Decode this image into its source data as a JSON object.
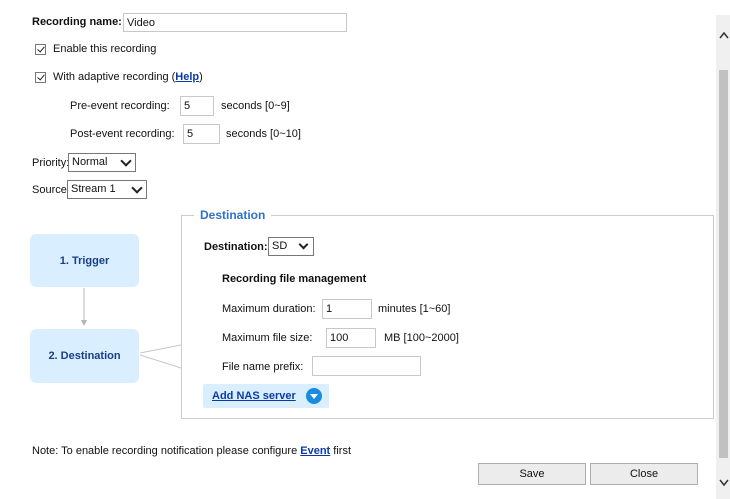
{
  "recording_name": {
    "label": "Recording name:",
    "value": "Video"
  },
  "enable_recording": {
    "label": "Enable this recording",
    "checked": true
  },
  "adaptive": {
    "label_prefix": "With adaptive recording (",
    "help": "Help",
    "label_suffix": ")",
    "checked": true
  },
  "pre_event": {
    "label": "Pre-event recording:",
    "value": "5",
    "unit": "seconds [0~9]"
  },
  "post_event": {
    "label": "Post-event recording:",
    "value": "5",
    "unit": "seconds [0~10]"
  },
  "priority": {
    "label": "Priority:",
    "value": "Normal"
  },
  "source": {
    "label": "Source:",
    "value": "Stream 1"
  },
  "flow": {
    "trigger": "1. Trigger",
    "destination": "2. Destination"
  },
  "destination_panel": {
    "legend": "Destination",
    "dest_label": "Destination:",
    "dest_value": "SD",
    "file_mgmt_title": "Recording file management",
    "max_duration": {
      "label": "Maximum duration:",
      "value": "1",
      "unit": "minutes [1~60]"
    },
    "max_size": {
      "label": "Maximum file size:",
      "value": "100",
      "unit": "MB [100~2000]"
    },
    "prefix": {
      "label": "File name prefix:",
      "value": ""
    },
    "add_nas": "Add NAS server"
  },
  "note": {
    "prefix": "Note: To enable recording notification please configure ",
    "link": "Event",
    "suffix": " first"
  },
  "buttons": {
    "save": "Save",
    "close": "Close"
  },
  "colors": {
    "accent": "#2f72c8",
    "box_fill": "#d9efff",
    "link": "#0b3aa8"
  }
}
